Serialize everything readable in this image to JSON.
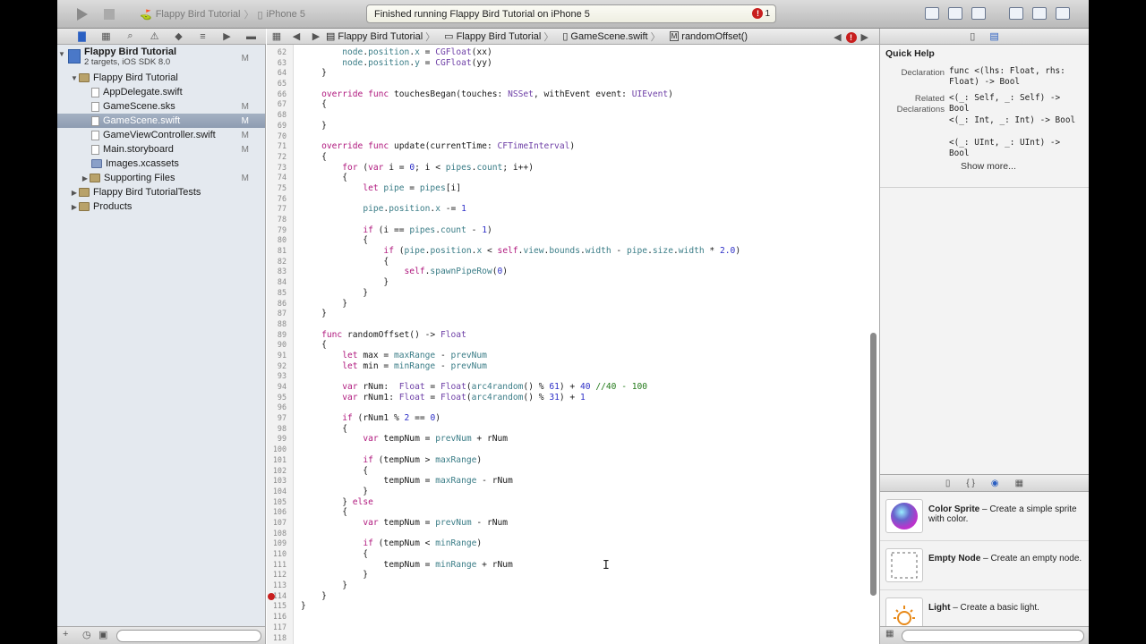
{
  "toolbar": {
    "scheme_target": "Flappy Bird Tutorial",
    "scheme_device": "iPhone 5",
    "activity_text": "Finished running Flappy Bird Tutorial on iPhone 5",
    "issue_count": "1"
  },
  "navigator": {
    "items": [
      {
        "label": "Flappy Bird Tutorial",
        "sub": "2 targets, iOS SDK 8.0",
        "scm": "M"
      },
      {
        "label": "Flappy Bird Tutorial",
        "scm": ""
      },
      {
        "label": "AppDelegate.swift",
        "scm": ""
      },
      {
        "label": "GameScene.sks",
        "scm": "M"
      },
      {
        "label": "GameScene.swift",
        "scm": "M"
      },
      {
        "label": "GameViewController.swift",
        "scm": "M"
      },
      {
        "label": "Main.storyboard",
        "scm": "M"
      },
      {
        "label": "Images.xcassets",
        "scm": ""
      },
      {
        "label": "Supporting Files",
        "scm": "M"
      },
      {
        "label": "Flappy Bird TutorialTests",
        "scm": ""
      },
      {
        "label": "Products",
        "scm": ""
      }
    ]
  },
  "jumpbar": {
    "crumbs": [
      "Flappy Bird Tutorial",
      "Flappy Bird Tutorial",
      "GameScene.swift",
      "randomOffset()"
    ]
  },
  "editor": {
    "lines": [
      {
        "n": "62",
        "t": "        node.position.x = CGFloat(xx)"
      },
      {
        "n": "63",
        "t": "        node.position.y = CGFloat(yy)"
      },
      {
        "n": "64",
        "t": "    }"
      },
      {
        "n": "65",
        "t": ""
      },
      {
        "n": "66",
        "t": "    override func touchesBegan(touches: NSSet, withEvent event: UIEvent)"
      },
      {
        "n": "67",
        "t": "    {"
      },
      {
        "n": "68",
        "t": ""
      },
      {
        "n": "69",
        "t": "    }"
      },
      {
        "n": "70",
        "t": ""
      },
      {
        "n": "71",
        "t": "    override func update(currentTime: CFTimeInterval)"
      },
      {
        "n": "72",
        "t": "    {"
      },
      {
        "n": "73",
        "t": "        for (var i = 0; i < pipes.count; i++)"
      },
      {
        "n": "74",
        "t": "        {"
      },
      {
        "n": "75",
        "t": "            let pipe = pipes[i]"
      },
      {
        "n": "76",
        "t": ""
      },
      {
        "n": "77",
        "t": "            pipe.position.x -= 1"
      },
      {
        "n": "78",
        "t": ""
      },
      {
        "n": "79",
        "t": "            if (i == pipes.count - 1)"
      },
      {
        "n": "80",
        "t": "            {"
      },
      {
        "n": "81",
        "t": "                if (pipe.position.x < self.view.bounds.width - pipe.size.width * 2.0)"
      },
      {
        "n": "82",
        "t": "                {"
      },
      {
        "n": "83",
        "t": "                    self.spawnPipeRow(0)"
      },
      {
        "n": "84",
        "t": "                }"
      },
      {
        "n": "85",
        "t": "            }"
      },
      {
        "n": "86",
        "t": "        }"
      },
      {
        "n": "87",
        "t": "    }"
      },
      {
        "n": "88",
        "t": ""
      },
      {
        "n": "89",
        "t": "    func randomOffset() -> Float"
      },
      {
        "n": "90",
        "t": "    {"
      },
      {
        "n": "91",
        "t": "        let max = maxRange - prevNum"
      },
      {
        "n": "92",
        "t": "        let min = minRange - prevNum"
      },
      {
        "n": "93",
        "t": ""
      },
      {
        "n": "94",
        "t": "        var rNum:  Float = Float(arc4random() % 61) + 40 //40 - 100"
      },
      {
        "n": "95",
        "t": "        var rNum1: Float = Float(arc4random() % 31) + 1"
      },
      {
        "n": "96",
        "t": ""
      },
      {
        "n": "97",
        "t": "        if (rNum1 % 2 == 0)"
      },
      {
        "n": "98",
        "t": "        {"
      },
      {
        "n": "99",
        "t": "            var tempNum = prevNum + rNum"
      },
      {
        "n": "100",
        "t": ""
      },
      {
        "n": "101",
        "t": "            if (tempNum > maxRange)"
      },
      {
        "n": "102",
        "t": "            {"
      },
      {
        "n": "103",
        "t": "                tempNum = maxRange - rNum"
      },
      {
        "n": "104",
        "t": "            }"
      },
      {
        "n": "105",
        "t": "        } else"
      },
      {
        "n": "106",
        "t": "        {"
      },
      {
        "n": "107",
        "t": "            var tempNum = prevNum - rNum"
      },
      {
        "n": "108",
        "t": ""
      },
      {
        "n": "109",
        "t": "            if (tempNum < minRange)"
      },
      {
        "n": "110",
        "t": "            {"
      },
      {
        "n": "111",
        "t": "                tempNum = minRange + rNum"
      },
      {
        "n": "112",
        "t": "            }"
      },
      {
        "n": "113",
        "t": "        }"
      },
      {
        "n": "114",
        "t": "    }"
      },
      {
        "n": "115",
        "t": "}"
      },
      {
        "n": "116",
        "t": ""
      },
      {
        "n": "117",
        "t": ""
      },
      {
        "n": "118",
        "t": ""
      }
    ],
    "error_line": "114"
  },
  "quickhelp": {
    "title": "Quick Help",
    "declaration_label": "Declaration",
    "declaration": "func <(lhs: Float, rhs: Float) -> Bool",
    "related_label": "Related Declarations",
    "related": [
      "<(_: Self, _: Self) -> Bool",
      "<(_: Int, _: Int) -> Bool",
      "<(_: UInt, _: UInt) -> Bool"
    ],
    "show_more": "Show more..."
  },
  "library": {
    "items": [
      {
        "name": "Color Sprite",
        "desc": " – Create a simple sprite with color."
      },
      {
        "name": "Empty Node",
        "desc": " – Create an empty node."
      },
      {
        "name": "Light",
        "desc": " – Create a basic light."
      }
    ]
  },
  "colors": {
    "keyword": "#b0197e",
    "type": "#6f41a7",
    "member": "#3b7d87",
    "number": "#2c2ec7",
    "comment": "#237a1a",
    "selection": "#8e9cb1"
  }
}
